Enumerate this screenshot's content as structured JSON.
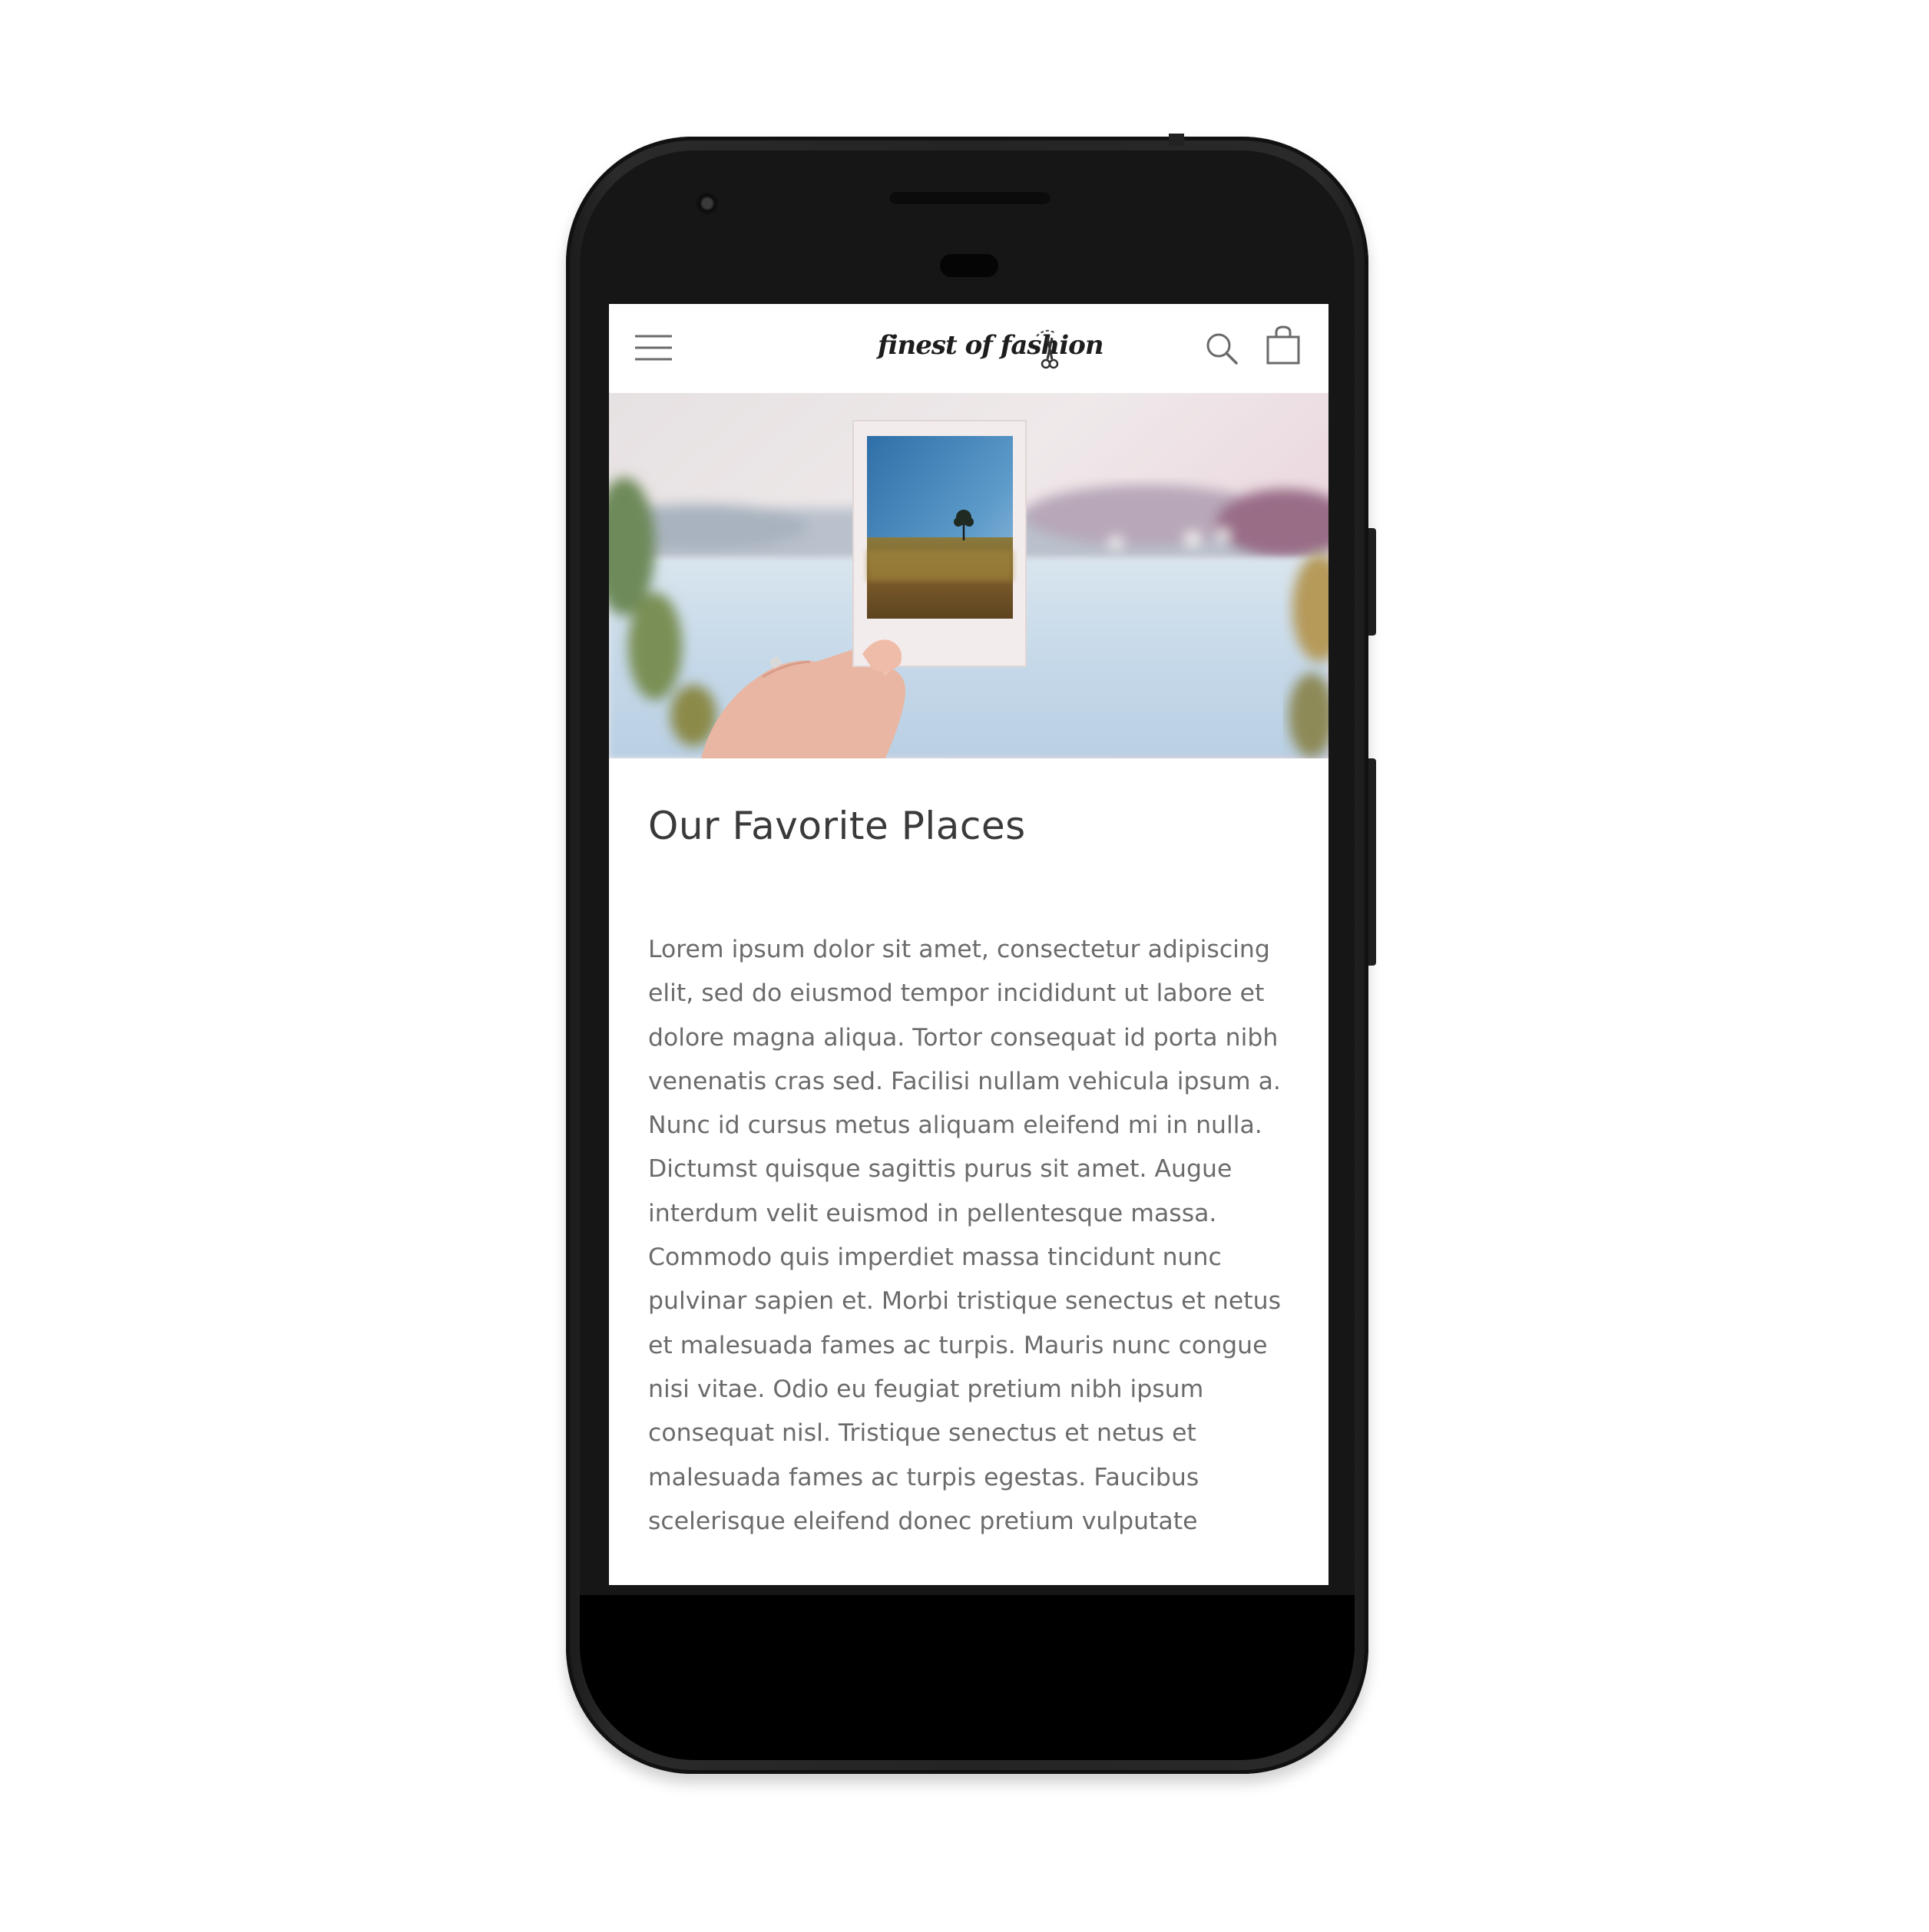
{
  "header": {
    "logo_text": "finest of fashion"
  },
  "icons": {
    "menu": "hamburger-menu-icon",
    "search": "search-icon",
    "cart": "shopping-bag-icon",
    "logo_mark": "scissors-icon"
  },
  "hero": {
    "image_description": "hand holding instant photo of a lone tree in a field, blurred lakeside background"
  },
  "article": {
    "title": "Our Favorite Places",
    "body": "Lorem ipsum dolor sit amet, consectetur adipiscing elit, sed do eiusmod tempor incididunt ut labore et dolore magna aliqua. Tortor consequat id porta nibh venenatis cras sed. Facilisi nullam vehicula ipsum a. Nunc id cursus metus aliquam eleifend mi in nulla. Dictumst quisque sagittis purus sit amet. Augue interdum velit euismod in pellentesque massa. Commodo quis imperdiet massa tincidunt nunc pulvinar sapien et. Morbi tristique senectus et netus et malesuada fames ac turpis. Mauris nunc congue nisi vitae. Odio eu feugiat pretium nibh ipsum consequat nisl. Tristique senectus et netus et malesuada fames ac turpis egestas. Faucibus scelerisque eleifend donec pretium vulputate"
  },
  "colors": {
    "device_body": "#242424",
    "screen_background": "#ffffff",
    "title_text": "#3a3a3a",
    "body_text": "#6b6b6b",
    "icon_stroke": "#555555"
  }
}
